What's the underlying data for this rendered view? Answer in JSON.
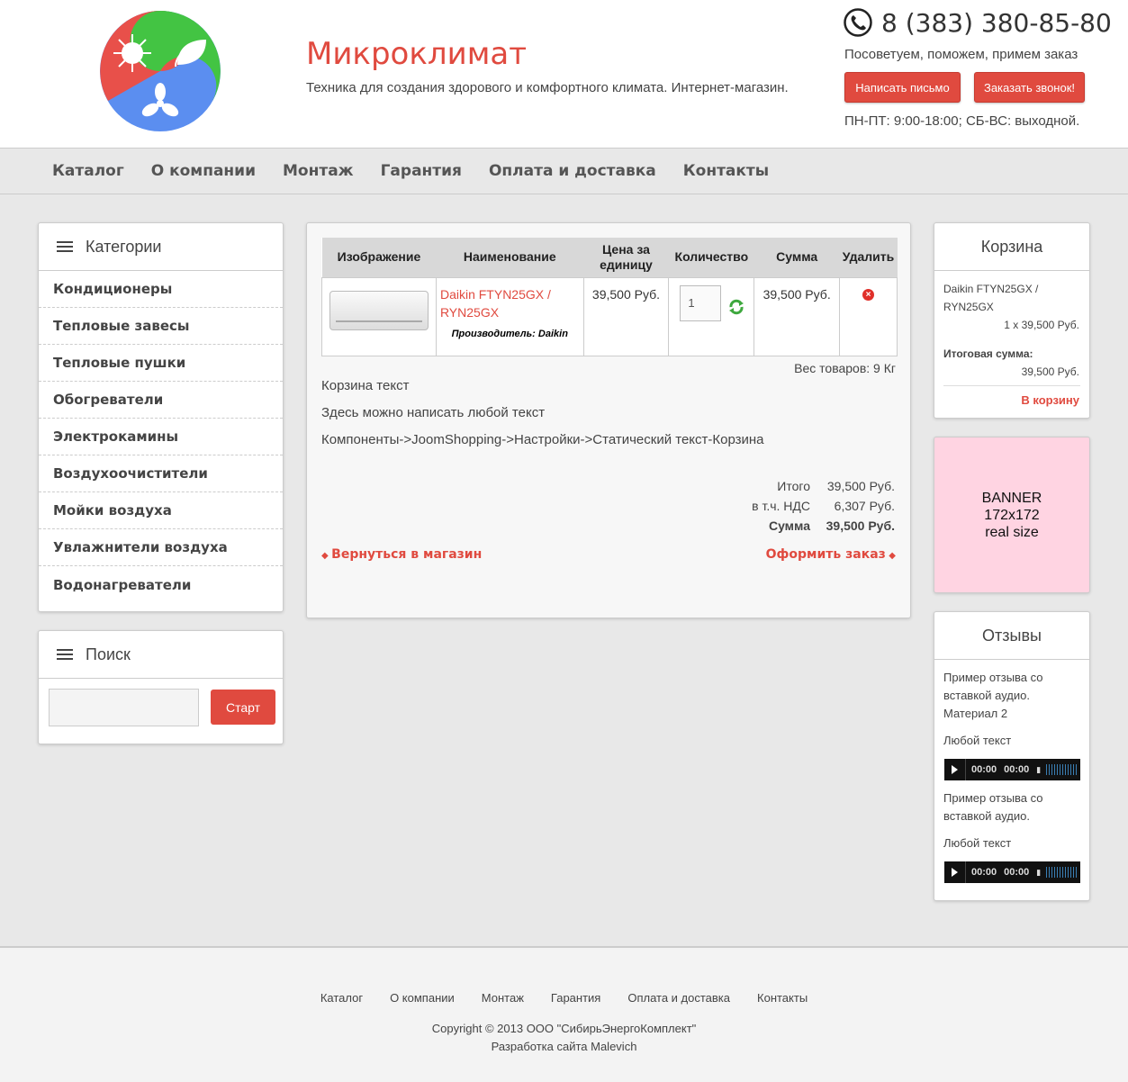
{
  "header": {
    "title": "Микроклимат",
    "description": "Техника для создания здорового и комфортного климата. Интернет-магазин.",
    "phone": "8 (383) 380-85-80",
    "tagline": "Посоветуем, поможем, примем заказ",
    "btn_write": "Написать письмо",
    "btn_call": "Заказать звонок!",
    "hours": "ПН-ПТ: 9:00-18:00; СБ-ВС: выходной."
  },
  "nav": [
    "Каталог",
    "О компании",
    "Монтаж",
    "Гарантия",
    "Оплата и доставка",
    "Контакты"
  ],
  "categories": {
    "title": "Категории",
    "items": [
      "Кондиционеры",
      "Тепловые завесы",
      "Тепловые пушки",
      "Обогреватели",
      "Электрокамины",
      "Воздухоочистители",
      "Мойки воздуха",
      "Увлажнители воздуха",
      "Водонагреватели"
    ]
  },
  "search": {
    "title": "Поиск",
    "button": "Старт",
    "value": ""
  },
  "cart": {
    "headers": [
      "Изображение",
      "Наименование",
      "Цена за единицу",
      "Количество",
      "Сумма",
      "Удалить"
    ],
    "item": {
      "name": "Daikin FTYN25GX / RYN25GX",
      "maker": "Производитель: Daikin",
      "price": "39,500 Руб.",
      "qty": "1",
      "sum": "39,500 Руб."
    },
    "weight": "Вес товаров: 9 Кг",
    "static_lines": [
      "Корзина текст",
      "Здесь можно написать любой текст",
      "Компоненты->JoomShopping->Настройки->Статический текст-Корзина"
    ],
    "totals": {
      "subtotal_label": "Итого",
      "subtotal": "39,500 Руб.",
      "vat_label": "в т.ч. НДС",
      "vat": "6,307 Руб.",
      "total_label": "Сумма",
      "total": "39,500 Руб."
    },
    "back_link": "Вернуться в магазин",
    "checkout_link": "Оформить заказ"
  },
  "minicart": {
    "title": "Корзина",
    "item": "Daikin FTYN25GX / RYN25GX",
    "item_qty": "1 x 39,500 Руб.",
    "total_label": "Итоговая сумма:",
    "total": "39,500 Руб.",
    "link": "В корзину"
  },
  "banner": {
    "line1": "BANNER",
    "line2": "172x172",
    "line3": "real size"
  },
  "reviews": {
    "title": "Отзывы",
    "r1": "Пример отзыва со вставкой аудио. Материал 2",
    "r1_text": "Любой текст",
    "r2": "Пример отзыва со вставкой аудио.",
    "r2_text": "Любой текст",
    "time": "00:00"
  },
  "footer": {
    "nav": [
      "Каталог",
      "О компании",
      "Монтаж",
      "Гарантия",
      "Оплата и доставка",
      "Контакты"
    ],
    "copyright": "Copyright © 2013 ООО \"СибирьЭнергоКомплект\"",
    "developer": "Разработка сайта Malevich"
  },
  "colors": {
    "accent": "#e04a3f",
    "banner": "#ffd4e2"
  }
}
